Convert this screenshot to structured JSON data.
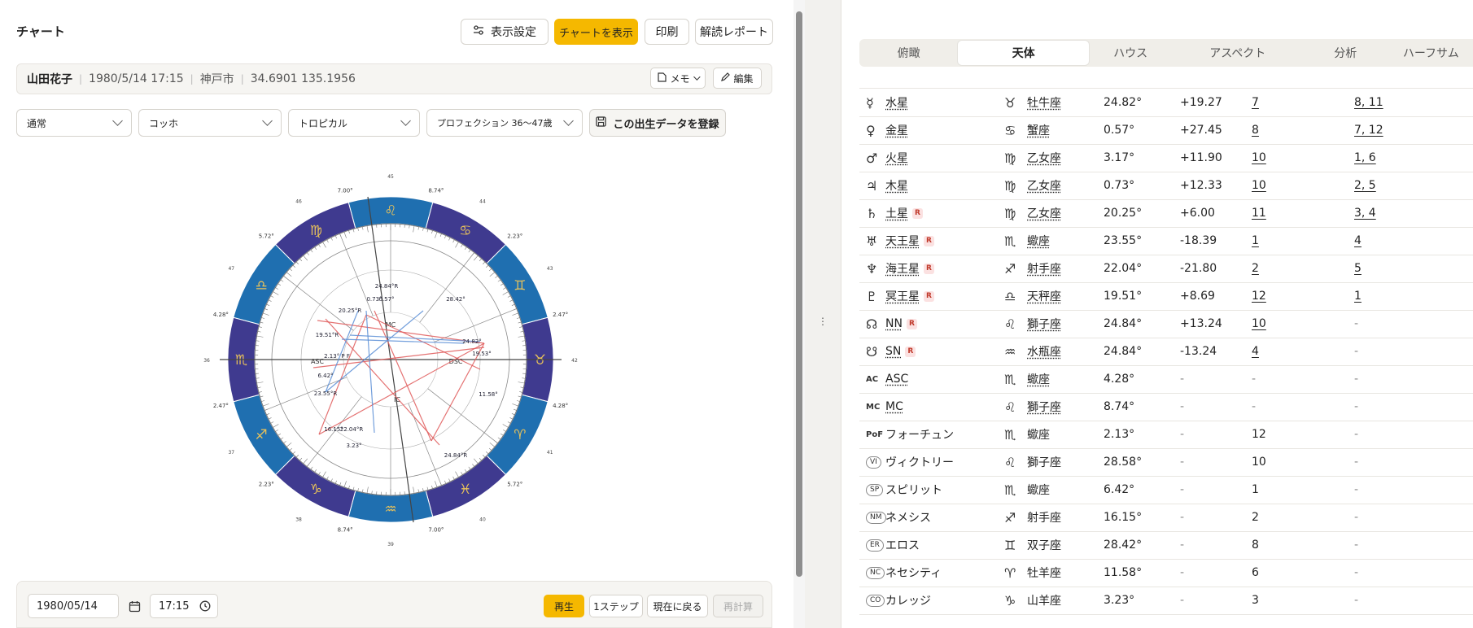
{
  "header": {
    "title": "チャート",
    "buttons": {
      "settings": "表示設定",
      "show_chart": "チャートを表示",
      "print": "印刷",
      "report": "解読レポート"
    }
  },
  "subject": {
    "name": "山田花子",
    "datetime": "1980/5/14 17:15",
    "place": "神戸市",
    "coords": "34.6901 135.1956",
    "memo": "メモ",
    "edit": "編集"
  },
  "options": {
    "mode": "通常",
    "house_system": "コッホ",
    "zodiac": "トロピカル",
    "progression": "プロフェクション 36〜47歳",
    "register": "この出生データを登録"
  },
  "wheel": {
    "zodiac_glyphs": [
      "♌",
      "♋",
      "♊",
      "♉",
      "♈",
      "♓",
      "♒",
      "♑",
      "♐",
      "♏",
      "♎",
      "♍"
    ],
    "outer_labels": [
      "8.74°",
      "2.23°",
      "2.47°",
      "4.28°",
      "5.72°",
      "7.00°",
      "8.74°",
      "2.23°",
      "2.47°",
      "4.28°",
      "5.72°",
      "7.00°"
    ],
    "house_numbers": [
      "45",
      "44",
      "43",
      "42",
      "41",
      "40",
      "39",
      "38",
      "37",
      "36",
      "47",
      "46"
    ],
    "angles": {
      "asc": "ASC",
      "dsc": "DSC",
      "mc": "MC",
      "ic": "IC"
    },
    "planet_labels": [
      "24.84°R",
      "0.73°",
      "0.57°",
      "20.25°R",
      "28.42°",
      "24.82°",
      "19.53°",
      "19.51°R",
      "2.13° P F",
      "6.42°",
      "23.55°R",
      "11.58°",
      "16.15°",
      "22.04°R",
      "3.23°",
      "24.84°R"
    ]
  },
  "playback": {
    "date": "1980/05/14",
    "time": "17:15",
    "play": "再生",
    "step": "1ステップ",
    "now": "現在に戻る",
    "recalc": "再計算"
  },
  "tabs": [
    "俯瞰",
    "天体",
    "ハウス",
    "アスペクト",
    "分析",
    "ハーフサム"
  ],
  "active_tab": "天体",
  "planets": [
    {
      "glyph": "☿",
      "name": "水星",
      "retro": false,
      "sign_glyph": "♉",
      "sign": "牡牛座",
      "deg": "24.82°",
      "speed": "+19.27",
      "house": "7",
      "rules": "8, 11"
    },
    {
      "glyph": "♀",
      "name": "金星",
      "retro": false,
      "sign_glyph": "♋",
      "sign": "蟹座",
      "deg": "0.57°",
      "speed": "+27.45",
      "house": "8",
      "rules": "7, 12"
    },
    {
      "glyph": "♂",
      "name": "火星",
      "retro": false,
      "sign_glyph": "♍",
      "sign": "乙女座",
      "deg": "3.17°",
      "speed": "+11.90",
      "house": "10",
      "rules": "1, 6"
    },
    {
      "glyph": "♃",
      "name": "木星",
      "retro": false,
      "sign_glyph": "♍",
      "sign": "乙女座",
      "deg": "0.73°",
      "speed": "+12.33",
      "house": "10",
      "rules": "2, 5"
    },
    {
      "glyph": "♄",
      "name": "土星",
      "retro": true,
      "sign_glyph": "♍",
      "sign": "乙女座",
      "deg": "20.25°",
      "speed": "+6.00",
      "house": "11",
      "rules": "3, 4"
    },
    {
      "glyph": "♅",
      "name": "天王星",
      "retro": true,
      "sign_glyph": "♏",
      "sign": "蠍座",
      "deg": "23.55°",
      "speed": "-18.39",
      "house": "1",
      "rules": "4"
    },
    {
      "glyph": "♆",
      "name": "海王星",
      "retro": true,
      "sign_glyph": "♐",
      "sign": "射手座",
      "deg": "22.04°",
      "speed": "-21.80",
      "house": "2",
      "rules": "5"
    },
    {
      "glyph": "♇",
      "name": "冥王星",
      "retro": true,
      "sign_glyph": "♎",
      "sign": "天秤座",
      "deg": "19.51°",
      "speed": "+8.69",
      "house": "12",
      "rules": "1"
    },
    {
      "glyph": "☊",
      "name": "NN",
      "retro": true,
      "sign_glyph": "♌",
      "sign": "獅子座",
      "deg": "24.84°",
      "speed": "+13.24",
      "house": "10",
      "rules": "-"
    },
    {
      "glyph": "☋",
      "name": "SN",
      "retro": true,
      "sign_glyph": "♒",
      "sign": "水瓶座",
      "deg": "24.84°",
      "speed": "-13.24",
      "house": "4",
      "rules": "-"
    }
  ],
  "points": [
    {
      "abbr": "AC",
      "name": "ASC",
      "type": "abbr",
      "sign_glyph": "♏",
      "sign": "蠍座",
      "deg": "4.28°",
      "speed": "-",
      "house": "-",
      "rules": "-"
    },
    {
      "abbr": "MC",
      "name": "MC",
      "type": "abbr",
      "sign_glyph": "♌",
      "sign": "獅子座",
      "deg": "8.74°",
      "speed": "-",
      "house": "-",
      "rules": "-"
    },
    {
      "abbr": "PoF",
      "name": "フォーチュン",
      "type": "abbr",
      "sign_glyph": "♏",
      "sign": "蠍座",
      "deg": "2.13°",
      "speed": "-",
      "house": "12",
      "rules": "-"
    },
    {
      "abbr": "VI",
      "name": "ヴィクトリー",
      "type": "pill",
      "sign_glyph": "♌",
      "sign": "獅子座",
      "deg": "28.58°",
      "speed": "-",
      "house": "10",
      "rules": "-"
    },
    {
      "abbr": "SP",
      "name": "スピリット",
      "type": "pill",
      "sign_glyph": "♏",
      "sign": "蠍座",
      "deg": "6.42°",
      "speed": "-",
      "house": "1",
      "rules": "-"
    },
    {
      "abbr": "NM",
      "name": "ネメシス",
      "type": "pill",
      "sign_glyph": "♐",
      "sign": "射手座",
      "deg": "16.15°",
      "speed": "-",
      "house": "2",
      "rules": "-"
    },
    {
      "abbr": "ER",
      "name": "エロス",
      "type": "pill",
      "sign_glyph": "♊",
      "sign": "双子座",
      "deg": "28.42°",
      "speed": "-",
      "house": "8",
      "rules": "-"
    },
    {
      "abbr": "NC",
      "name": "ネセシティ",
      "type": "pill",
      "sign_glyph": "♈",
      "sign": "牡羊座",
      "deg": "11.58°",
      "speed": "-",
      "house": "6",
      "rules": "-"
    },
    {
      "abbr": "CO",
      "name": "カレッジ",
      "type": "pill",
      "sign_glyph": "♑",
      "sign": "山羊座",
      "deg": "3.23°",
      "speed": "-",
      "house": "3",
      "rules": "-"
    }
  ],
  "retro_badge": "R",
  "colors": {
    "accent": "#f5b800",
    "wheel_dark": "#3f3a8f",
    "wheel_light": "#1f6fb0",
    "aspect_red": "#e05a5a",
    "aspect_blue": "#5b8fd6"
  }
}
